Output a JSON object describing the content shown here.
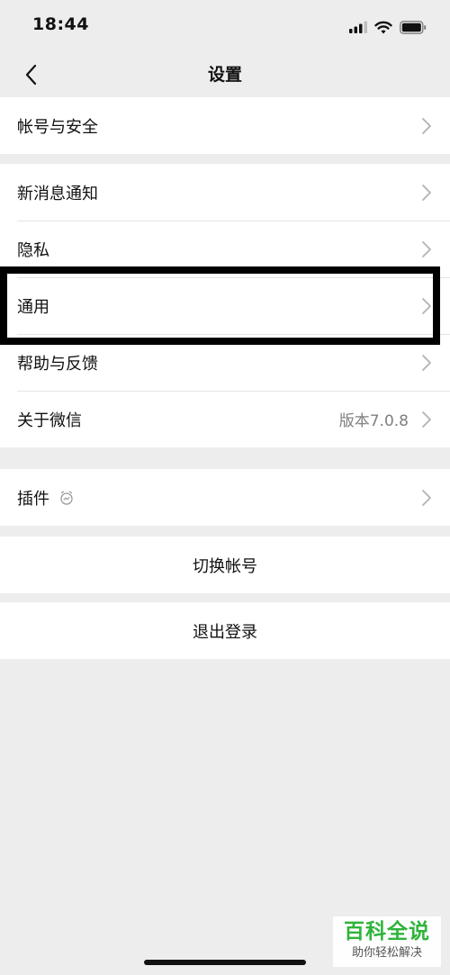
{
  "status_bar": {
    "time": "18:44"
  },
  "nav": {
    "title": "设置"
  },
  "groups": {
    "account": {
      "label": "帐号与安全"
    },
    "main": {
      "new_message": "新消息通知",
      "privacy": "隐私",
      "general": "通用",
      "help": "帮助与反馈",
      "about": "关于微信",
      "about_value": "版本7.0.8"
    },
    "plugins": {
      "label": "插件"
    },
    "switch_account": {
      "label": "切换帐号"
    },
    "logout": {
      "label": "退出登录"
    }
  },
  "watermark": {
    "title": "百科全说",
    "subtitle": "助你轻松解决"
  },
  "colors": {
    "background": "#ededed",
    "card": "#ffffff",
    "accent_green": "#2eb43a",
    "secondary_text": "#7f7f7f"
  },
  "icons": {
    "back": "chevron-left-icon",
    "row_arrow": "chevron-right-icon",
    "plugin": "plugin-clock-icon"
  }
}
